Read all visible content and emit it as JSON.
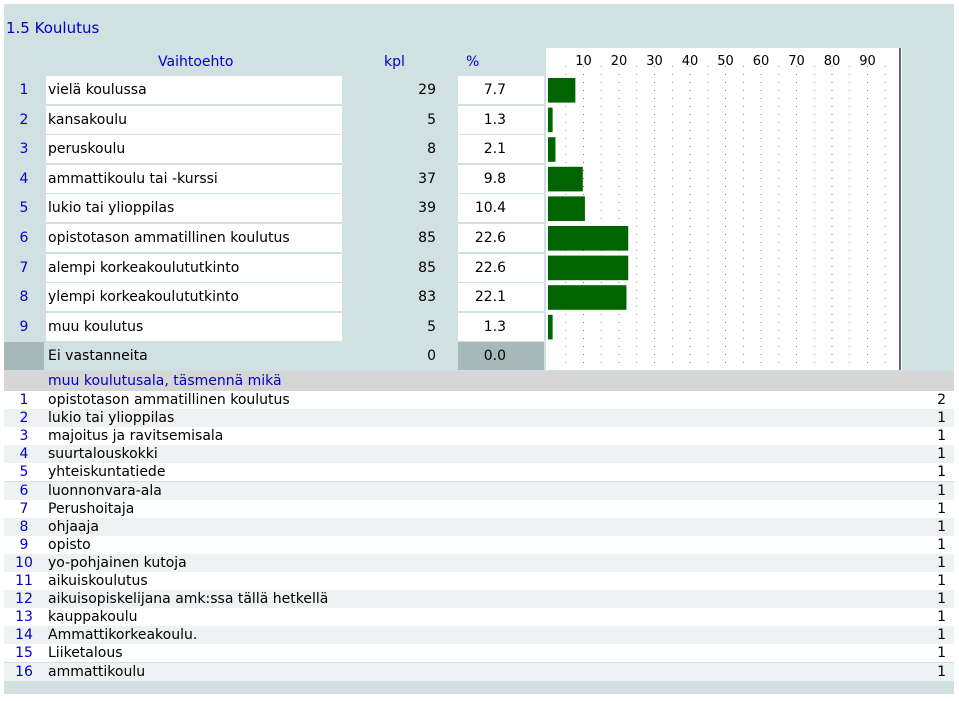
{
  "section_title": "1.5 Koulutus",
  "table1": {
    "col_option": "Vaihtoehto",
    "col_count": "kpl",
    "col_percent": "%",
    "rows": [
      {
        "num": "1",
        "label": "vielä koulussa",
        "count": "29",
        "percent": "7.7"
      },
      {
        "num": "2",
        "label": "kansakoulu",
        "count": "5",
        "percent": "1.3"
      },
      {
        "num": "3",
        "label": "peruskoulu",
        "count": "8",
        "percent": "2.1"
      },
      {
        "num": "4",
        "label": "ammattikoulu tai -kurssi",
        "count": "37",
        "percent": "9.8"
      },
      {
        "num": "5",
        "label": "lukio tai ylioppilas",
        "count": "39",
        "percent": "10.4"
      },
      {
        "num": "6",
        "label": "opistotason ammatillinen koulutus",
        "count": "85",
        "percent": "22.6"
      },
      {
        "num": "7",
        "label": "alempi korkeakoulututkinto",
        "count": "85",
        "percent": "22.6"
      },
      {
        "num": "8",
        "label": "ylempi korkeakoulututkinto",
        "count": "83",
        "percent": "22.1"
      },
      {
        "num": "9",
        "label": "muu koulutus",
        "count": "5",
        "percent": "1.3"
      },
      {
        "num": "",
        "label": "Ei vastanneita",
        "count": "0",
        "percent": "0.0"
      }
    ]
  },
  "chart_data": {
    "type": "bar",
    "orientation": "horizontal",
    "categories": [
      "vielä koulussa",
      "kansakoulu",
      "peruskoulu",
      "ammattikoulu tai -kurssi",
      "lukio tai ylioppilas",
      "opistotason ammatillinen koulutus",
      "alempi korkeakoulututkinto",
      "ylempi korkeakoulututkinto",
      "muu koulutus",
      "Ei vastanneita"
    ],
    "values": [
      7.7,
      1.3,
      2.1,
      9.8,
      10.4,
      22.6,
      22.6,
      22.1,
      1.3,
      0.0
    ],
    "xlim": [
      0,
      100
    ],
    "ticks": [
      "10",
      "20",
      "30",
      "40",
      "50",
      "60",
      "70",
      "80",
      "90"
    ],
    "bar_color": "#006400",
    "grid": true
  },
  "table2": {
    "header": "muu koulutusala, täsmennä mikä",
    "rows": [
      {
        "num": "1",
        "label": "opistotason ammatillinen koulutus",
        "value": "2"
      },
      {
        "num": "2",
        "label": "lukio tai ylioppilas",
        "value": "1"
      },
      {
        "num": "3",
        "label": "majoitus ja ravitsemisala",
        "value": "1"
      },
      {
        "num": "4",
        "label": "suurtalouskokki",
        "value": "1"
      },
      {
        "num": "5",
        "label": "yhteiskuntatiede",
        "value": "1"
      },
      {
        "num": "6",
        "label": "luonnonvara-ala",
        "value": "1"
      },
      {
        "num": "7",
        "label": "Perushoitaja",
        "value": "1"
      },
      {
        "num": "8",
        "label": "ohjaaja",
        "value": "1"
      },
      {
        "num": "9",
        "label": "opisto",
        "value": "1"
      },
      {
        "num": "10",
        "label": "yo-pohjainen kutoja",
        "value": "1"
      },
      {
        "num": "11",
        "label": "aikuiskoulutus",
        "value": "1"
      },
      {
        "num": "12",
        "label": "aikuisopiskelijana amk:ssa tällä hetkellä",
        "value": "1"
      },
      {
        "num": "13",
        "label": "kauppakoulu",
        "value": "1"
      },
      {
        "num": "14",
        "label": "Ammattikorkeakoulu.",
        "value": "1"
      },
      {
        "num": "15",
        "label": "Liiketalous",
        "value": "1"
      },
      {
        "num": "16",
        "label": "ammattikoulu",
        "value": "1"
      }
    ]
  },
  "colors": {
    "link_blue": "#0000c8",
    "panel": "#d1e0e0",
    "grey_cell": "#a6b8b8",
    "alt_row": "#e8eeee"
  }
}
